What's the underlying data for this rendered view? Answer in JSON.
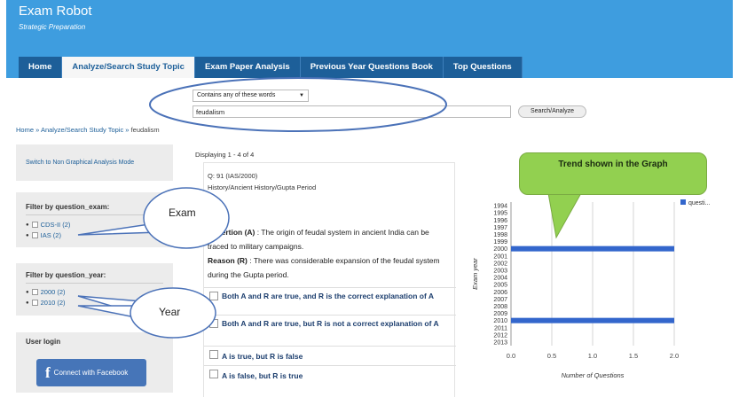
{
  "site": {
    "title": "Exam Robot",
    "tagline": "Strategic Preparation"
  },
  "nav": [
    "Home",
    "Analyze/Search Study Topic",
    "Exam Paper Analysis",
    "Previous Year Questions Book",
    "Top Questions"
  ],
  "search": {
    "mode": "Contains any of these words",
    "query": "feudalism",
    "button": "Search/Analyze"
  },
  "breadcrumb": {
    "home": "Home",
    "sep1": "»",
    "section": "Analyze/Search Study Topic",
    "sep2": "»",
    "current": "feudalism"
  },
  "sidebar": {
    "switch_link": "Switch to Non Graphical Analysis Mode",
    "exam_title": "Filter by question_exam:",
    "exam_filters": [
      "CDS-II (2)",
      "IAS (2)"
    ],
    "year_title": "Filter by question_year:",
    "year_filters": [
      "2000 (2)",
      "2010 (2)"
    ],
    "login_title": "User login",
    "facebook_btn": "Connect with Facebook"
  },
  "results": {
    "displaying": "Displaying 1 - 4 of 4"
  },
  "question": {
    "id": "Q: 91 (IAS/2000)",
    "category": "History/Ancient History/Gupta Period",
    "assertion_label": "Assertion (A)",
    "assertion_text": " : The origin of feudal system in ancient India can be traced to military campaigns.",
    "reason_label": "Reason (R)",
    "reason_text": " : There was considerable expansion of the feudal system during the Gupta period.",
    "options": [
      "Both A and R are true, and R is the correct explanation of A",
      "Both A and R are true, but R is not a correct explanation of A",
      "A is true, but R is false",
      "A is false, but R is true"
    ]
  },
  "annotations": {
    "graph_callout": "Trend shown in the Graph",
    "exam_bubble": "Exam",
    "year_bubble": "Year"
  },
  "colors": {
    "header": "#3e9ddf",
    "nav": "#1d5f99",
    "bar": "#3366cc",
    "callout": "#92d050"
  },
  "chart_data": {
    "type": "bar",
    "orientation": "horizontal",
    "categories": [
      "1994",
      "1995",
      "1996",
      "1997",
      "1998",
      "1999",
      "2000",
      "2001",
      "2002",
      "2003",
      "2004",
      "2005",
      "2006",
      "2007",
      "2008",
      "2009",
      "2010",
      "2011",
      "2012",
      "2013"
    ],
    "series": [
      {
        "name": "questi...",
        "values": [
          0,
          0,
          0,
          0,
          0,
          0,
          2,
          0,
          0,
          0,
          0,
          0,
          0,
          0,
          0,
          0,
          2,
          0,
          0,
          0
        ]
      }
    ],
    "xlabel": "Number of Questions",
    "ylabel": "Exam year",
    "xlim": [
      0,
      2.0
    ],
    "xticks": [
      "0.0",
      "0.5",
      "1.0",
      "1.5",
      "2.0"
    ],
    "grid": true,
    "legend": "top-right"
  }
}
